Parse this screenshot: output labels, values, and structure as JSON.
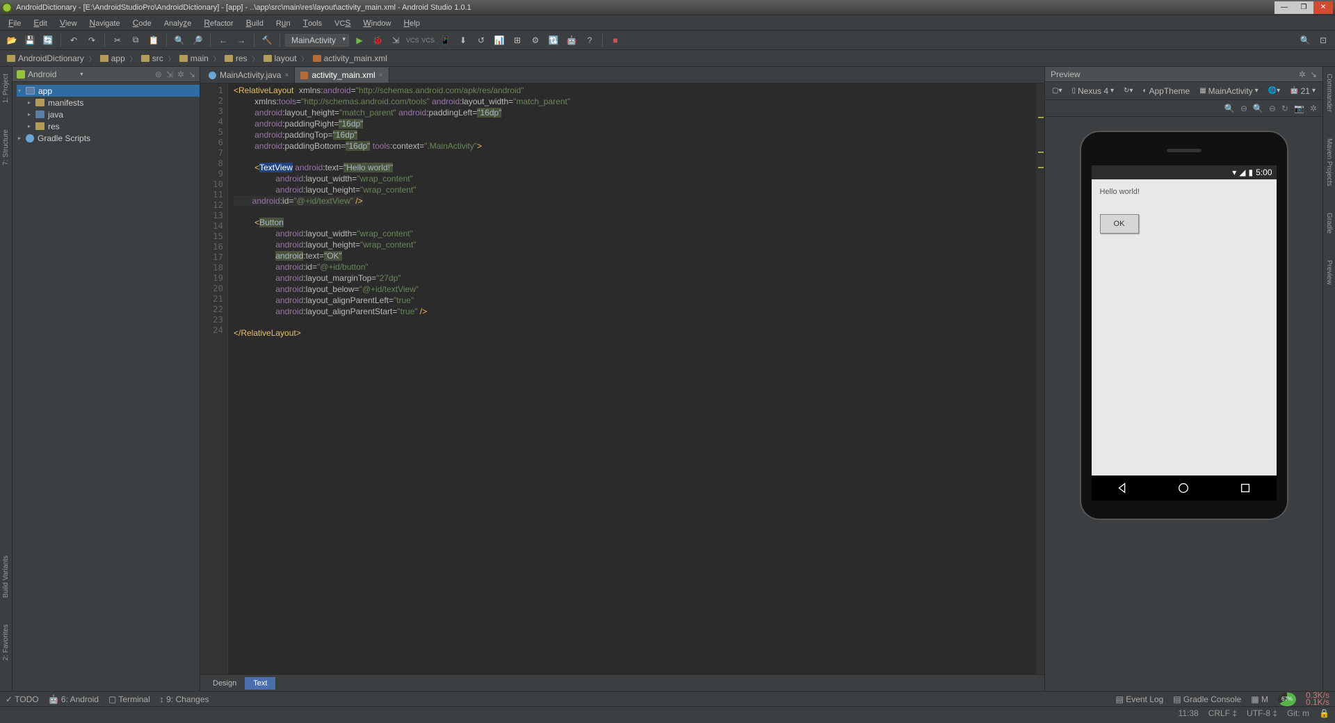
{
  "titlebar": {
    "text": "AndroidDictionary - [E:\\AndroidStudioPro\\AndroidDictionary] - [app] - ..\\app\\src\\main\\res\\layout\\activity_main.xml - Android Studio 1.0.1"
  },
  "menu": [
    "File",
    "Edit",
    "View",
    "Navigate",
    "Code",
    "Analyze",
    "Refactor",
    "Build",
    "Run",
    "Tools",
    "VCS",
    "Window",
    "Help"
  ],
  "toolbar": {
    "config": "MainActivity",
    "vcs1": "VCS",
    "vcs2": "VCS"
  },
  "breadcrumbs": [
    "AndroidDictionary",
    "app",
    "src",
    "main",
    "res",
    "layout",
    "activity_main.xml"
  ],
  "project": {
    "dropdown": "Android",
    "tree": {
      "app": "app",
      "manifests": "manifests",
      "java": "java",
      "res": "res",
      "gradle": "Gradle Scripts"
    }
  },
  "tabs": {
    "t1": "MainActivity.java",
    "t2": "activity_main.xml"
  },
  "code": {
    "lines": 24,
    "l1a": "<RelativeLayout",
    "l1b": "xmlns:",
    "l1c": "android",
    "l1d": "=",
    "l1e": "\"http://schemas.android.com/apk/res/android\"",
    "l2a": "xmlns:",
    "l2b": "tools",
    "l2c": "=",
    "l2d": "\"http://schemas.android.com/tools\"",
    "l2e": " android",
    "l2f": ":layout_width=",
    "l2g": "\"match_parent\"",
    "l3a": "android",
    "l3b": ":layout_height=",
    "l3c": "\"match_parent\"",
    "l3d": " android",
    "l3e": ":paddingLeft=",
    "l3f": "\"16dp\"",
    "l4a": "android",
    "l4b": ":paddingRight=",
    "l4c": "\"16dp\"",
    "l5a": "android",
    "l5b": ":paddingTop=",
    "l5c": "\"16dp\"",
    "l6a": "android",
    "l6b": ":paddingBottom=",
    "l6c": "\"16dp\"",
    "l6d": " tools",
    "l6e": ":context=",
    "l6f": "\".MainActivity\"",
    "l6g": ">",
    "l8a": "<",
    "l8b": "TextView",
    "l8c": " android",
    "l8d": ":text=",
    "l8e": "\"Hello world!\"",
    "l9a": "android",
    "l9b": ":layout_width=",
    "l9c": "\"wrap_content\"",
    "l10a": "android",
    "l10b": ":layout_height=",
    "l10c": "\"wrap_content\"",
    "l11a": "android",
    "l11b": ":id=",
    "l11c": "\"@+id/textView\"",
    "l11d": " />",
    "l13a": "<",
    "l13b": "Button",
    "l14a": "android",
    "l14b": ":layout_width=",
    "l14c": "\"wrap_content\"",
    "l15a": "android",
    "l15b": ":layout_height=",
    "l15c": "\"wrap_content\"",
    "l16a": "android",
    "l16b": ":text=",
    "l16c": "\"OK\"",
    "l17a": "android",
    "l17b": ":id=",
    "l17c": "\"@+id/button\"",
    "l18a": "android",
    "l18b": ":layout_marginTop=",
    "l18c": "\"27dp\"",
    "l19a": "android",
    "l19b": ":layout_below=",
    "l19c": "\"@+id/textView\"",
    "l20a": "android",
    "l20b": ":layout_alignParentLeft=",
    "l20c": "\"true\"",
    "l21a": "android",
    "l21b": ":layout_alignParentStart=",
    "l21c": "\"true\"",
    "l21d": " />",
    "l23a": "</RelativeLayout>"
  },
  "editorTabs": {
    "design": "Design",
    "text": "Text"
  },
  "preview": {
    "title": "Preview",
    "device": "Nexus 4",
    "theme": "AppTheme",
    "activity": "MainActivity",
    "api": "21",
    "time": "5:00",
    "hello": "Hello world!",
    "ok": "OK"
  },
  "bottom": {
    "todo": "TODO",
    "android": "6: Android",
    "terminal": "Terminal",
    "changes": "9: Changes",
    "eventlog": "Event Log",
    "gradle": "Gradle Console",
    "m": "M",
    "mem": "67%",
    "net1": "0.3K/s",
    "net2": "0.1K/s"
  },
  "status": {
    "pos": "11:38",
    "crlf": "CRLF",
    "enc": "UTF-8",
    "git": "Git: m"
  },
  "rails": {
    "left": [
      "1: Project",
      "7: Structure",
      "Build Variants",
      "2: Favorites"
    ],
    "right": [
      "Maven Projects",
      "Gradle",
      "Preview",
      "Commander"
    ]
  }
}
